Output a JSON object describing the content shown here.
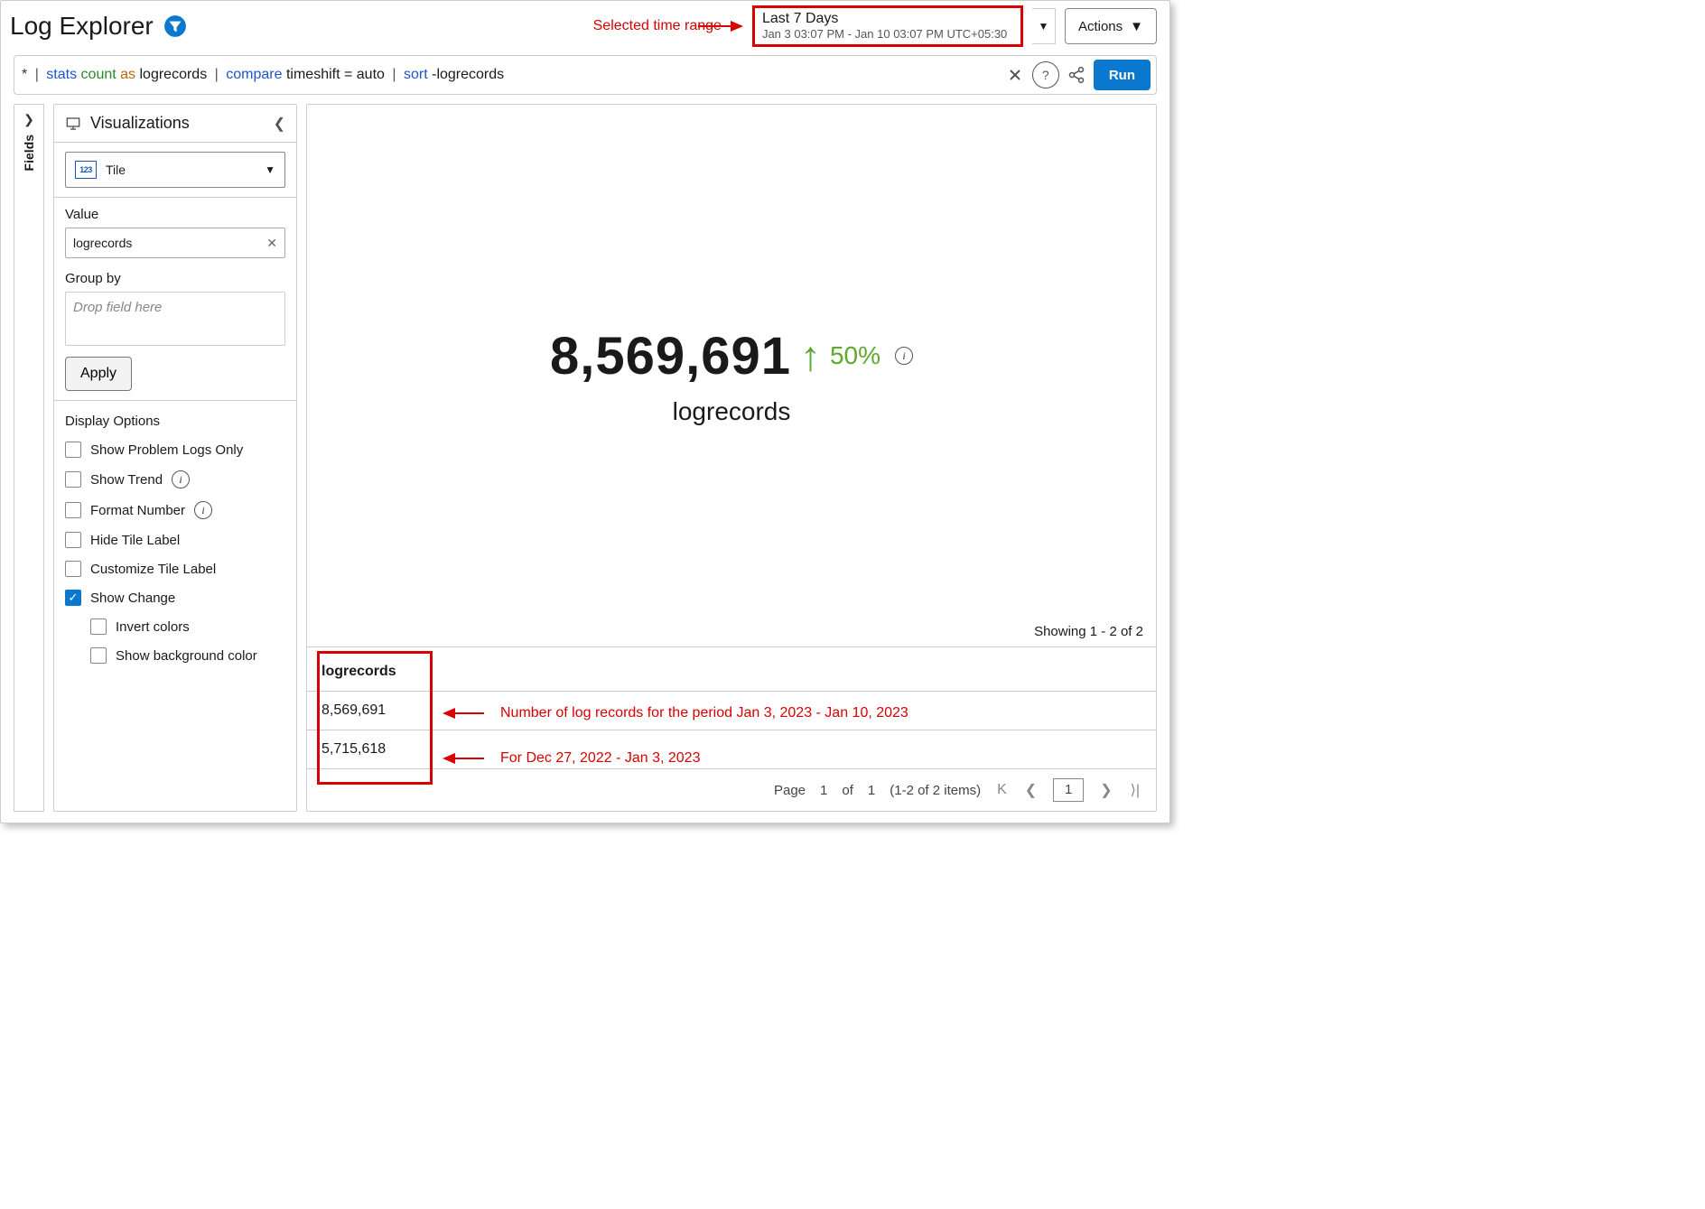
{
  "header": {
    "title": "Log Explorer",
    "annotation_label": "Selected time range",
    "time_range_main": "Last 7 Days",
    "time_range_sub": "Jan 3 03:07 PM - Jan 10 03:07 PM UTC+05:30",
    "actions_label": "Actions"
  },
  "query": {
    "star": "*",
    "pipe": "|",
    "kw_stats": "stats",
    "fn_count": "count",
    "kw_as": "as",
    "alias": "logrecords",
    "kw_compare": "compare",
    "timeshift_txt": "timeshift = auto",
    "kw_sort": "sort",
    "sort_txt": "-logrecords",
    "run_label": "Run"
  },
  "fields_tab": "Fields",
  "side": {
    "title": "Visualizations",
    "viz_type": "Tile",
    "value_label": "Value",
    "value_pill": "logrecords",
    "groupby_label": "Group by",
    "groupby_placeholder": "Drop field here",
    "apply": "Apply",
    "display_options": "Display Options",
    "opts": {
      "problem": "Show Problem Logs Only",
      "trend": "Show Trend",
      "format": "Format Number",
      "hide": "Hide Tile Label",
      "customize": "Customize Tile Label",
      "change": "Show Change",
      "invert": "Invert colors",
      "bg": "Show background color"
    }
  },
  "tile": {
    "big_value": "8,569,691",
    "change_pct": "50%",
    "label": "logrecords"
  },
  "table": {
    "showing": "Showing 1 - 2 of 2",
    "header": "logrecords",
    "rows": [
      "8,569,691",
      "5,715,618"
    ],
    "annot1": "Number of log records for the period Jan 3, 2023 - Jan 10, 2023",
    "annot2": "For Dec 27, 2022 - Jan 3, 2023"
  },
  "pager": {
    "page_lbl": "Page",
    "page_cur": "1",
    "of": "of",
    "total": "1",
    "range": "(1-2 of 2 items)"
  },
  "chart_data": {
    "type": "table",
    "title": "logrecords",
    "columns": [
      "logrecords"
    ],
    "rows": [
      [
        8569691
      ],
      [
        5715618
      ]
    ],
    "change_percent": 50,
    "change_direction": "up",
    "periods": [
      "Jan 3, 2023 - Jan 10, 2023",
      "Dec 27, 2022 - Jan 3, 2023"
    ]
  }
}
